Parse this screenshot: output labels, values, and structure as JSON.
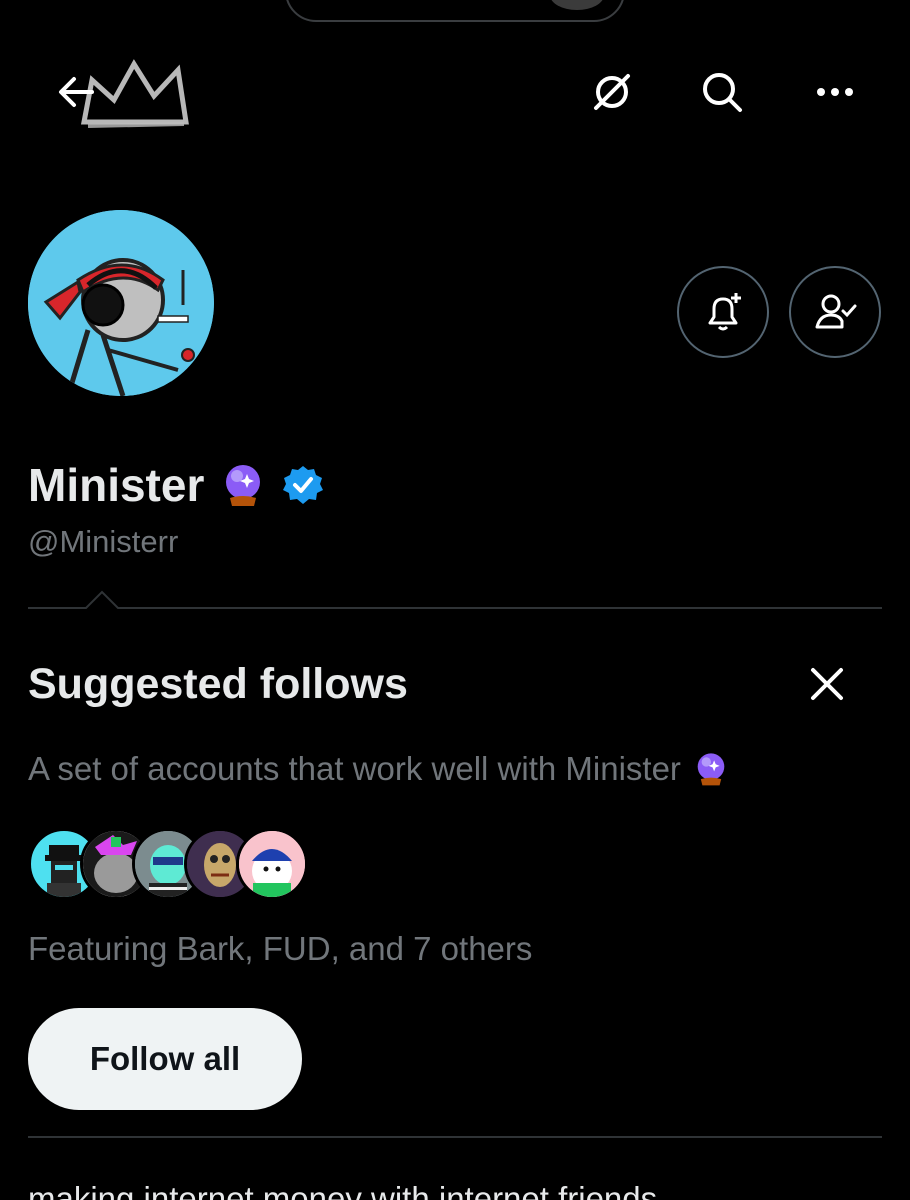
{
  "header": {
    "back_icon": "arrow-left-icon",
    "banner_icon": "crown-icon",
    "grok_icon": "grok-icon",
    "search_icon": "search-icon",
    "more_icon": "ellipsis-icon"
  },
  "profile": {
    "display_name": "Minister",
    "handle": "@Ministerr",
    "verified": true,
    "verified_color": "#1d9bf0",
    "notify_icon": "bell-plus-icon",
    "following_icon": "person-check-icon"
  },
  "suggested": {
    "title": "Suggested follows",
    "description": "A set of accounts that work well with Minister",
    "featuring": "Featuring Bark, FUD, and 7 others",
    "follow_all_label": "Follow all",
    "close_icon": "close-icon"
  },
  "bio": "making internet money with internet friends",
  "colors": {
    "background": "#000000",
    "primary_text": "#e7e9ea",
    "secondary_text": "#71767b",
    "divider": "#2f3336",
    "avatar_bg": "#5ec9ec"
  }
}
